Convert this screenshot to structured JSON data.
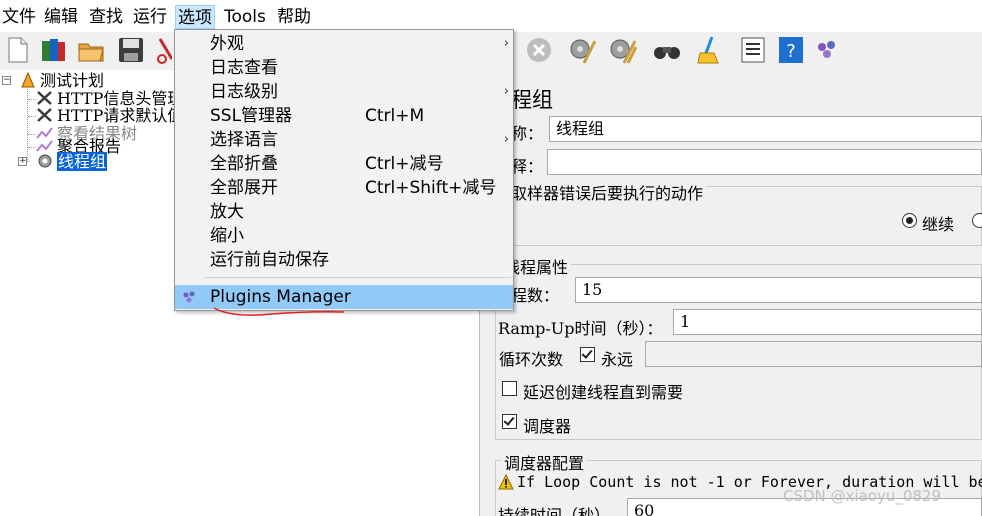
{
  "menubar": {
    "items": [
      "文件",
      "编辑",
      "查找",
      "运行",
      "选项",
      "Tools",
      "帮助"
    ],
    "active": "选项"
  },
  "toolbar": {
    "buttons": [
      "new-icon",
      "templates-icon",
      "open-icon",
      "save-icon",
      "cut-icon",
      "stop-icon",
      "clear-icon",
      "clear-all-icon",
      "search-icon",
      "reset-search-icon",
      "function-helper-icon",
      "help-icon",
      "plugins-icon"
    ]
  },
  "tree": {
    "root": "测试计划",
    "children": [
      {
        "label": "HTTP信息头管理器"
      },
      {
        "label": "HTTP请求默认值"
      },
      {
        "label": "察看结果树"
      },
      {
        "label": "聚合报告"
      },
      {
        "label": "线程组"
      }
    ]
  },
  "dropdown": {
    "items": [
      {
        "label": "外观",
        "shortcut": "",
        "submenu": true
      },
      {
        "label": "日志查看",
        "shortcut": "",
        "submenu": false
      },
      {
        "label": "日志级别",
        "shortcut": "",
        "submenu": true
      },
      {
        "label": "SSL管理器",
        "shortcut": "Ctrl+M",
        "submenu": false
      },
      {
        "label": "选择语言",
        "shortcut": "",
        "submenu": true
      },
      {
        "label": "全部折叠",
        "shortcut": "Ctrl+减号",
        "submenu": false
      },
      {
        "label": "全部展开",
        "shortcut": "Ctrl+Shift+减号",
        "submenu": false
      },
      {
        "label": "放大",
        "shortcut": "",
        "submenu": false
      },
      {
        "label": "缩小",
        "shortcut": "",
        "submenu": false
      },
      {
        "label": "运行前自动保存",
        "shortcut": "",
        "submenu": false
      }
    ],
    "plugins_manager": "Plugins Manager",
    "submenu_arrow": "›"
  },
  "panel": {
    "title": "程组",
    "name_label": "称：",
    "name_value": "线程组",
    "comment_label": "释：",
    "comment_value": "",
    "on_error_title": "取样器错误后要执行的动作",
    "on_error_continue": "继续",
    "thread_props_title": "线程属性",
    "threads_label": "程数：",
    "threads_value": "15",
    "rampup_label": "Ramp-Up时间（秒）：",
    "rampup_value": "1",
    "loop_label": "循环次数",
    "loop_forever_label": "永远",
    "loop_value": "",
    "delay_create_label": "延迟创建线程直到需要",
    "scheduler_label": "调度器",
    "scheduler_config_title": "调度器配置",
    "warning_text": "If Loop Count is not -1 or Forever, duration will be",
    "duration_label": "持续时间（秒）",
    "duration_value": "60"
  },
  "watermark": "CSDN @xiaoyu_0829",
  "colors": {
    "selection": "#0a64d8",
    "menu_highlight": "#91c9f7",
    "menubar_active": "#cce8ff",
    "annotation_red": "#e02020"
  }
}
